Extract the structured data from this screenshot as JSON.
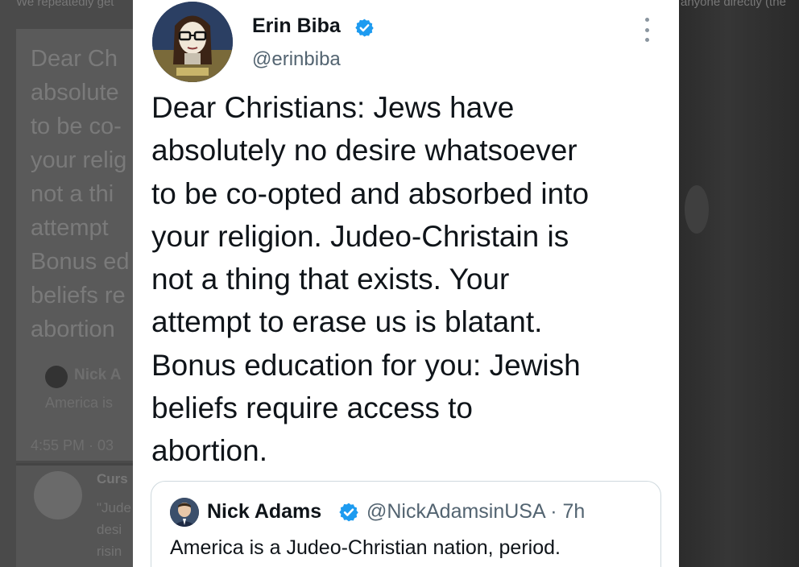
{
  "background": {
    "top_left_text": "We repeatedly get",
    "top_right_text": "anyone directly (the",
    "big_text_lines": [
      "Dear Ch",
      "absolute",
      "to be co-",
      "your relig",
      "not a thi",
      "attempt",
      "Bonus ed",
      "beliefs re",
      "abortion"
    ],
    "quote_name": "Nick A",
    "quote_text": "America is",
    "time": "4:55 PM · 03",
    "reply_name": "Curs",
    "reply_lines": [
      "\"Jude",
      "desi",
      "risin"
    ]
  },
  "tweet": {
    "display_name": "Erin Biba",
    "handle": "@erinbiba",
    "body_lines": [
      "Dear Christians: Jews have",
      "absolutely no desire whatsoever",
      "to be co-opted and absorbed into",
      "your religion. Judeo-Christain is",
      "not a thing that exists. Your",
      "attempt to erase us is blatant.",
      "Bonus education for you: Jewish",
      "beliefs require access to",
      "abortion."
    ],
    "quoted": {
      "display_name": "Nick Adams",
      "meta": "@NickAdamsinUSA · 7h",
      "text": "America is a Judeo-Christian nation, period."
    }
  },
  "colors": {
    "verified": "#1d9bf0",
    "text_primary": "#0f1419",
    "text_secondary": "#536471"
  },
  "icons": {
    "verified": "verified-badge-icon",
    "more": "more-options-icon"
  }
}
